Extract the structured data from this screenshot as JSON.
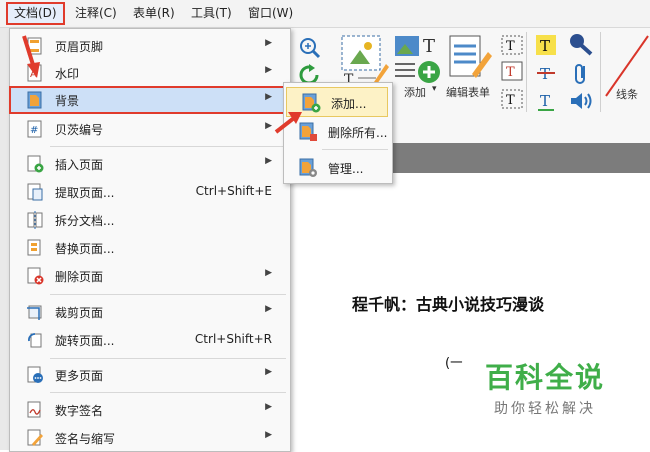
{
  "menubar": {
    "items": [
      "文档(D)",
      "注释(C)",
      "表单(R)",
      "工具(T)",
      "窗口(W)"
    ]
  },
  "toolbar": {
    "add_label": "添加",
    "edit_form_label": "编辑表单",
    "lines_label": "线条"
  },
  "doc_menu": {
    "items": [
      {
        "label": "页眉页脚"
      },
      {
        "label": "水印"
      },
      {
        "label": "背景"
      },
      {
        "label": "贝茨编号"
      },
      {
        "label": "插入页面"
      },
      {
        "label": "提取页面...",
        "shortcut": "Ctrl+Shift+E"
      },
      {
        "label": "拆分文档..."
      },
      {
        "label": "替换页面..."
      },
      {
        "label": "删除页面"
      },
      {
        "label": "裁剪页面"
      },
      {
        "label": "旋转页面...",
        "shortcut": "Ctrl+Shift+R"
      },
      {
        "label": "更多页面"
      },
      {
        "label": "数字签名"
      },
      {
        "label": "签名与缩写"
      }
    ]
  },
  "background_submenu": {
    "items": [
      "添加...",
      "删除所有...",
      "管理..."
    ]
  },
  "document": {
    "title": "程千帆：古典小说技巧漫谈",
    "paren": "(一"
  },
  "watermark": {
    "main": "百科全说",
    "sub": "助你轻松解决"
  },
  "colors": {
    "highlight_border": "#e03b2c",
    "submenu_highlight": "#fdf2c6",
    "watermark_green": "#3fae49"
  }
}
